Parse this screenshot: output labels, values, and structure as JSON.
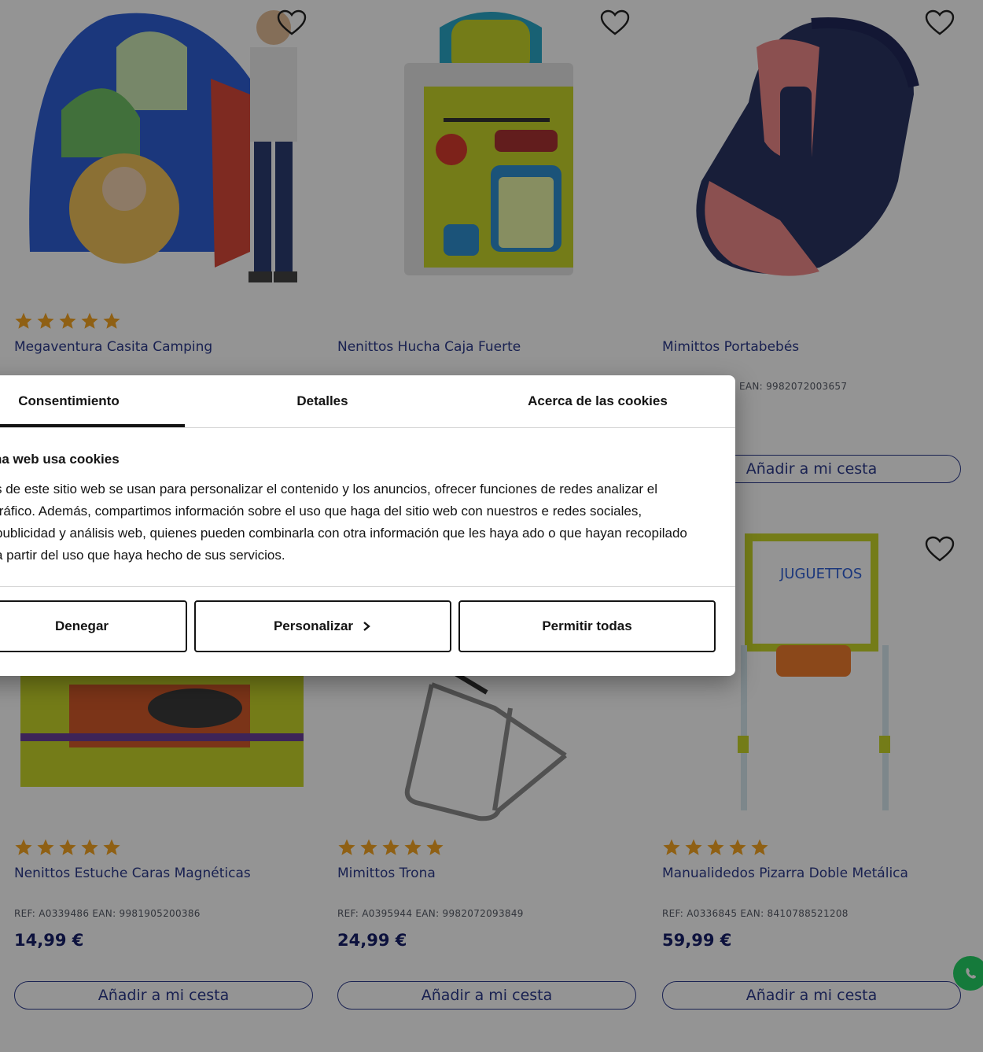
{
  "products": [
    {
      "name": "Megaventura Casita Camping",
      "ref": "",
      "price": "",
      "add_label": "",
      "icon": "tent-image"
    },
    {
      "name": "Nenittos Hucha Caja Fuerte",
      "ref": "",
      "price": "",
      "add_label": "",
      "icon": "safe-box-image"
    },
    {
      "name": "Mimittos Portabebés",
      "ref": "EAN: 9982072003657",
      "price": "",
      "add_label": "Añadir a mi cesta",
      "icon": "baby-carrier-image"
    },
    {
      "name": "Nenittos Estuche Caras Magnéticas",
      "ref": "REF: A0339486 EAN: 9981905200386",
      "price": "14,99 €",
      "add_label": "Añadir a mi cesta",
      "icon": "magnetic-faces-image"
    },
    {
      "name": "Mimittos Trona",
      "ref": "REF: A0395944 EAN: 9982072093849",
      "price": "24,99 €",
      "add_label": "Añadir a mi cesta",
      "icon": "high-chair-image"
    },
    {
      "name": "Manualidedos Pizarra Doble Metálica",
      "ref": "REF: A0336845 EAN: 8410788521208",
      "price": "59,99 €",
      "add_label": "Añadir a mi cesta",
      "icon": "easel-image"
    }
  ],
  "cookie_dialog": {
    "tabs": [
      "Consentimiento",
      "Detalles",
      "Acerca de las cookies"
    ],
    "title": "na web usa cookies",
    "body": "s de este sitio web se usan para personalizar el contenido y los anuncios, ofrecer funciones de redes analizar el tráfico. Además, compartimos información sobre el uso que haga del sitio web con nuestros e redes sociales, publicidad y análisis web, quienes pueden combinarla con otra información que les haya ado o que hayan recopilado a partir del uso que haya hecho de sus servicios.",
    "deny": "Denegar",
    "customize": "Personalizar",
    "allow_all": "Permitir todas"
  },
  "colors": {
    "brand": "#2b3a8c",
    "price": "#17206a",
    "star": "#f6a623",
    "whatsapp": "#25d366"
  }
}
